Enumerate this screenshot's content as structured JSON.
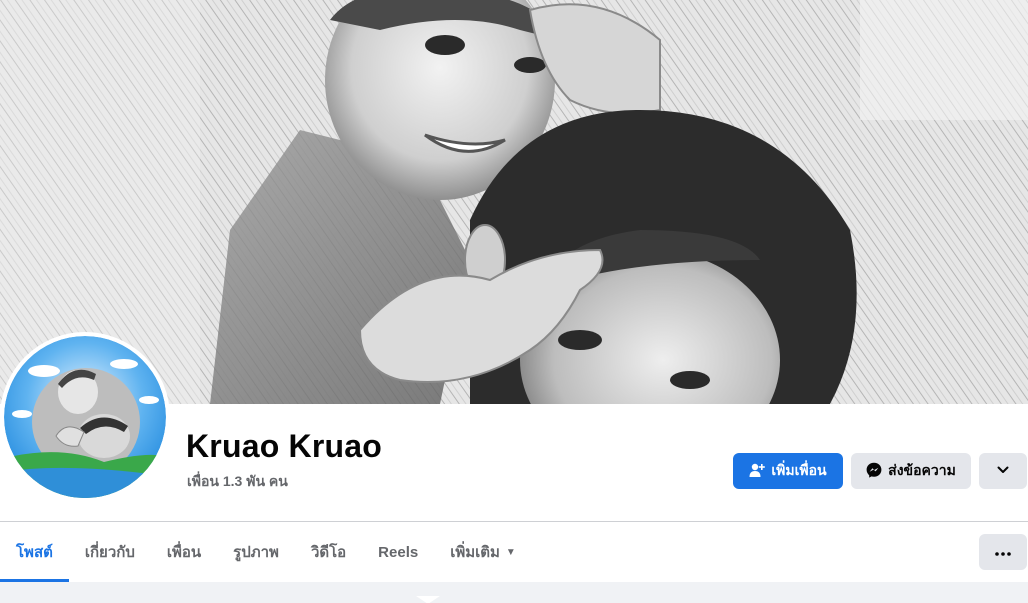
{
  "profile": {
    "name": "Kruao Kruao",
    "friends": "เพื่อน 1.3 พัน คน"
  },
  "actions": {
    "add_friend": "เพิ่มเพื่อน",
    "message": "ส่งข้อความ"
  },
  "tabs": [
    {
      "label": "โพสต์",
      "active": true
    },
    {
      "label": "เกี่ยวกับ",
      "active": false
    },
    {
      "label": "เพื่อน",
      "active": false
    },
    {
      "label": "รูปภาพ",
      "active": false
    },
    {
      "label": "วิดีโอ",
      "active": false
    },
    {
      "label": "Reels",
      "active": false
    },
    {
      "label": "เพิ่มเติม",
      "active": false
    }
  ],
  "colors": {
    "accent": "#1b74e4",
    "secondary_button": "#e4e6eb",
    "text_primary": "#050505",
    "text_secondary": "#65676b"
  },
  "icons": {
    "add_friend": "add-person-icon",
    "message": "messenger-icon",
    "dropdown": "chevron-down-icon",
    "more": "more-dots-icon"
  }
}
